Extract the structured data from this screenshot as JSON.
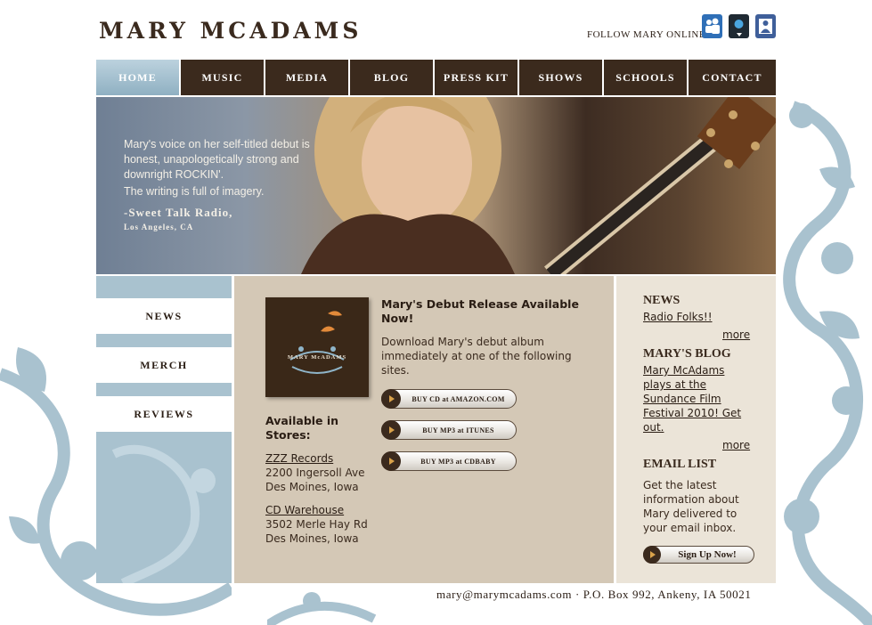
{
  "brand": {
    "logo_main": "MARY MC",
    "logo_small": "",
    "logo_rest": "ADAMS",
    "logo_full": "MARY MCADAMS"
  },
  "header": {
    "follow_label": "FOLLOW MARY ONLINE",
    "social": [
      {
        "icon": "myspace-icon",
        "color": "#2f6fb7"
      },
      {
        "icon": "twitter-icon",
        "color": "#1f2a33"
      },
      {
        "icon": "facebook-icon",
        "color": "#3f5f9a"
      }
    ]
  },
  "nav": [
    {
      "label": "HOME",
      "active": true
    },
    {
      "label": "MUSIC"
    },
    {
      "label": "MEDIA"
    },
    {
      "label": "BLOG"
    },
    {
      "label": "PRESS KIT"
    },
    {
      "label": "SHOWS"
    },
    {
      "label": "SCHOOLS"
    },
    {
      "label": "CONTACT"
    }
  ],
  "banner": {
    "quote_1": "Mary's voice on her self-titled debut is honest, unapologetically strong and downright ROCKIN'.",
    "quote_2": "The writing is full of imagery.",
    "source": "-Sweet Talk Radio,",
    "location": "Los Angeles, CA"
  },
  "sidebar": [
    {
      "label": "NEWS"
    },
    {
      "label": "MERCH"
    },
    {
      "label": "REVIEWS"
    }
  ],
  "main": {
    "album_label": "MARY McADAMS",
    "title": "Mary's Debut Release Available Now!",
    "description": "Download Mary's debut album immediately at one of the following sites.",
    "buttons": [
      {
        "label": "BUY CD at AMAZON.COM"
      },
      {
        "label": "BUY MP3 at ITUNES"
      },
      {
        "label": "BUY MP3 at CDBABY"
      }
    ],
    "stores_heading": "Available in Stores:",
    "stores": [
      {
        "name": "ZZZ Records",
        "addr1": "2200 Ingersoll Ave",
        "addr2": "Des Moines, Iowa"
      },
      {
        "name": "CD Warehouse",
        "addr1": "3502 Merle Hay Rd",
        "addr2": "Des Moines, Iowa"
      }
    ]
  },
  "right": {
    "news_heading": "NEWS",
    "news_link": "Radio Folks!!",
    "more_label": "more",
    "blog_heading": "MARY'S BLOG",
    "blog_link": "Mary McAdams plays at the Sundance Film Festival 2010! Get out.",
    "email_heading": "EMAIL LIST",
    "email_text": "Get the latest information about Mary delivered to your email inbox.",
    "signup_label": "Sign Up Now!"
  },
  "footer": {
    "text": "mary@marymcadams.com · P.O. Box 992, Ankeny, IA 50021"
  },
  "colors": {
    "brown": "#3b2a1d",
    "blue": "#a9c2cf",
    "tan": "#d4c8b6",
    "cream": "#ebe4d8"
  }
}
